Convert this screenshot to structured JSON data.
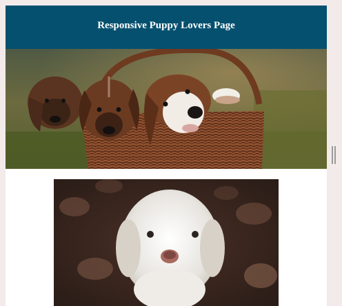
{
  "header": {
    "title": "Responsive Puppy Lovers Page",
    "background": "#06506f"
  },
  "images": [
    {
      "name": "puppies-in-basket",
      "description_icon": "photo-image"
    },
    {
      "name": "white-curly-puppy",
      "description_icon": "photo-image"
    }
  ],
  "colors": {
    "page_background": "#f3eaea",
    "content_background": "#ffffff"
  }
}
